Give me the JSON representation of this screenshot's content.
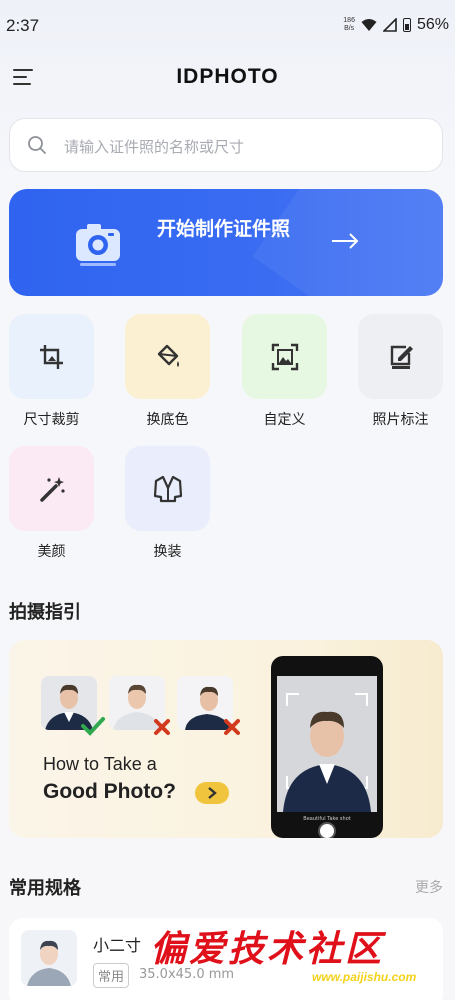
{
  "status_bar": {
    "time": "2:37",
    "net_speed_value": "186",
    "net_speed_unit": "B/s",
    "battery": "56%"
  },
  "header": {
    "logo": "IDPHOTO"
  },
  "search": {
    "placeholder": "请输入证件照的名称或尺寸"
  },
  "banner": {
    "label": "开始制作证件照"
  },
  "tools": [
    {
      "label": "尺寸裁剪",
      "icon": "crop-icon",
      "bg": "#e9f1fc"
    },
    {
      "label": "换底色",
      "icon": "paint-bucket-icon",
      "bg": "#fcf0d2"
    },
    {
      "label": "自定义",
      "icon": "custom-frame-icon",
      "bg": "#e6f8e2"
    },
    {
      "label": "照片标注",
      "icon": "edit-note-icon",
      "bg": "#eeeff2"
    },
    {
      "label": "美颜",
      "icon": "magic-wand-icon",
      "bg": "#fbe9f3"
    },
    {
      "label": "换装",
      "icon": "clothes-icon",
      "bg": "#eaedfb"
    }
  ],
  "guide_section": {
    "title": "拍摄指引",
    "line1": "How to Take a",
    "line2": "Good Photo?",
    "phone_caption": "Beautiful  Take shot"
  },
  "spec_section": {
    "title": "常用规格",
    "more": "更多",
    "items": [
      {
        "name": "小二寸",
        "badge": "常用",
        "size": "35.0x45.0 mm"
      }
    ]
  },
  "watermark": {
    "text": "偏爱技术社区",
    "url": "www.paijishu.com"
  },
  "colors": {
    "accent": "#3168f1",
    "good": "#2fa84f",
    "bad": "#d23a1e",
    "watermark": "#e0101b"
  }
}
